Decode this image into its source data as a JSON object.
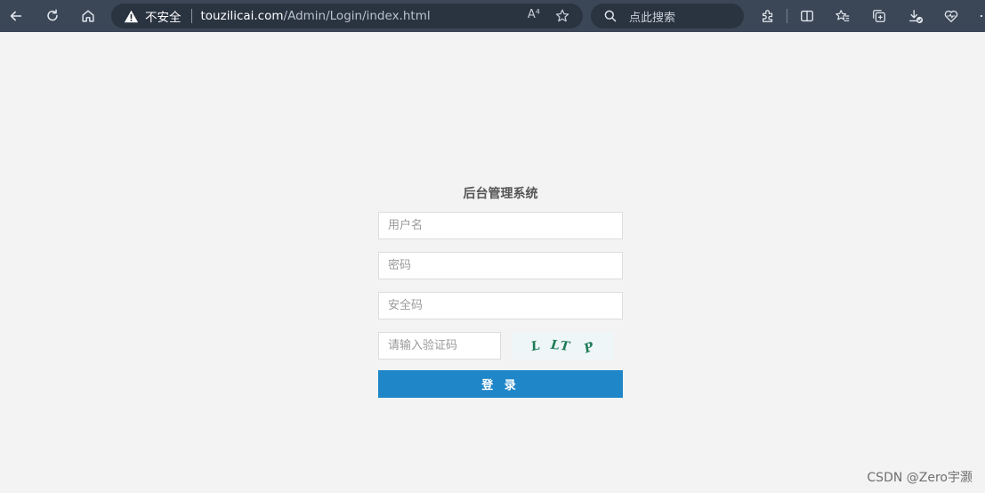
{
  "browser": {
    "security_label": "不安全",
    "url_domain": "touzilicai.com",
    "url_path": "/Admin/Login/index.html",
    "read_aloud_glyph": "A⁴",
    "search_placeholder": "点此搜索"
  },
  "login": {
    "title": "后台管理系统",
    "username_placeholder": "用户名",
    "password_placeholder": "密码",
    "security_code_placeholder": "安全码",
    "captcha_placeholder": "请输入验证码",
    "captcha_text": [
      "L",
      "LT",
      "P"
    ],
    "submit_label": "登 录"
  },
  "watermark": "CSDN @Zero宇灏",
  "colors": {
    "browser_bar": "#3b4656",
    "page_background": "#f3f3f3",
    "button": "#1f86c8",
    "captcha_text": "#1e7a55"
  }
}
